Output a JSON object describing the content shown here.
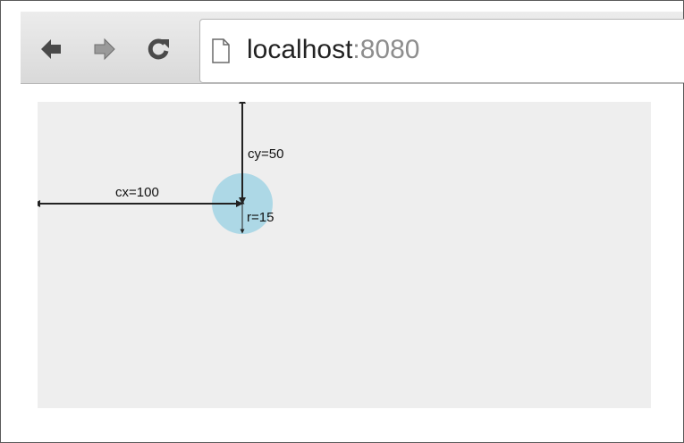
{
  "browser": {
    "nav": {
      "back_icon": "back-arrow-icon",
      "forward_icon": "forward-arrow-icon",
      "reload_icon": "reload-icon"
    },
    "address_bar": {
      "page_icon": "page-icon",
      "host": "localhost",
      "port": ":8080"
    }
  },
  "diagram": {
    "circle_color": "#add8e6",
    "background_color": "#eeeeee",
    "labels": {
      "cx": "cx=100",
      "cy": "cy=50",
      "r": "r=15"
    }
  }
}
